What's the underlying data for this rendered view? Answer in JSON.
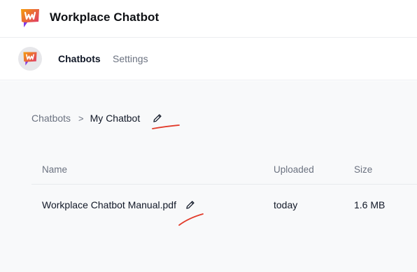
{
  "app": {
    "title": "Workplace Chatbot"
  },
  "nav": {
    "items": [
      {
        "label": "Chatbots",
        "active": true
      },
      {
        "label": "Settings",
        "active": false
      }
    ]
  },
  "breadcrumb": {
    "parent": "Chatbots",
    "separator": ">",
    "current": "My Chatbot"
  },
  "table": {
    "columns": [
      "Name",
      "Uploaded",
      "Size"
    ],
    "rows": [
      {
        "name": "Workplace Chatbot Manual.pdf",
        "uploaded": "today",
        "size": "1.6 MB"
      }
    ]
  },
  "icons": {
    "logo": "w-speech-flag-icon",
    "avatar": "w-speech-flag-icon",
    "edit": "pencil-icon"
  },
  "colors": {
    "logo_gradient_start": "#f59e0b",
    "logo_gradient_end": "#db2777",
    "logo_tail": "#7c3aed",
    "annotation": "#e23b2a"
  }
}
